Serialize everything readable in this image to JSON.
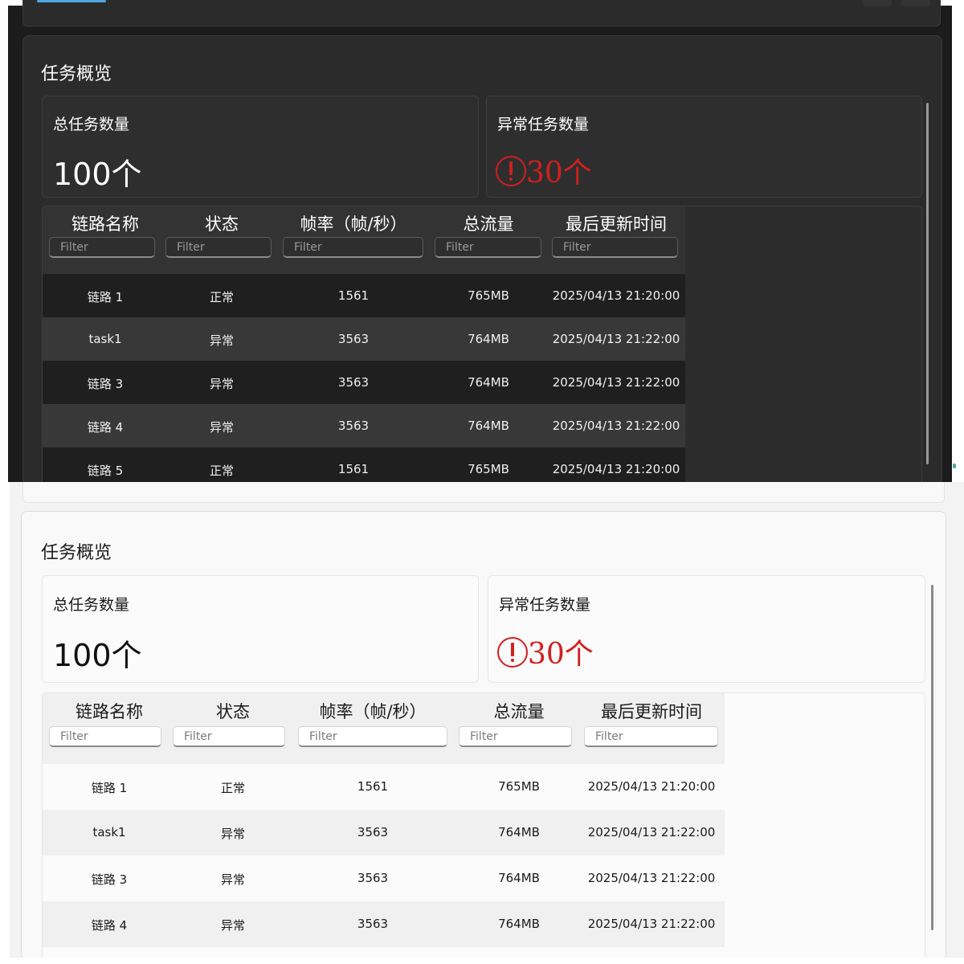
{
  "dark": {
    "section_title": "任务概览",
    "total_label": "总任务数量",
    "total_value": "100个",
    "abnormal_label": "异常任务数量",
    "abnormal_icon": "exclamation-circle-icon",
    "abnormal_value": "!30个",
    "columns": [
      "链路名称",
      "状态",
      "帧率（帧/秒）",
      "总流量",
      "最后更新时间"
    ],
    "filter_placeholder": "Filter",
    "rows": [
      [
        "链路 1",
        "正常",
        "1561",
        "765MB",
        "2025/04/13 21:20:00"
      ],
      [
        "task1",
        "异常",
        "3563",
        "764MB",
        "2025/04/13 21:22:00"
      ],
      [
        "链路 3",
        "异常",
        "3563",
        "764MB",
        "2025/04/13 21:22:00"
      ],
      [
        "链路 4",
        "异常",
        "3563",
        "764MB",
        "2025/04/13 21:22:00"
      ],
      [
        "链路 5",
        "正常",
        "1561",
        "765MB",
        "2025/04/13 21:20:00"
      ]
    ]
  },
  "light": {
    "section_title": "任务概览",
    "total_label": "总任务数量",
    "total_value": "100个",
    "abnormal_label": "异常任务数量",
    "abnormal_icon": "exclamation-circle-icon",
    "abnormal_value": "!30个",
    "columns": [
      "链路名称",
      "状态",
      "帧率（帧/秒）",
      "总流量",
      "最后更新时间"
    ],
    "filter_placeholder": "Filter",
    "rows": [
      [
        "链路 1",
        "正常",
        "1561",
        "765MB",
        "2025/04/13 21:20:00"
      ],
      [
        "task1",
        "异常",
        "3563",
        "764MB",
        "2025/04/13 21:22:00"
      ],
      [
        "链路 3",
        "异常",
        "3563",
        "764MB",
        "2025/04/13 21:22:00"
      ],
      [
        "链路 4",
        "异常",
        "3563",
        "764MB",
        "2025/04/13 21:22:00"
      ]
    ]
  },
  "colors": {
    "alert": "#d01f1f",
    "accent": "#4fa6e0"
  }
}
